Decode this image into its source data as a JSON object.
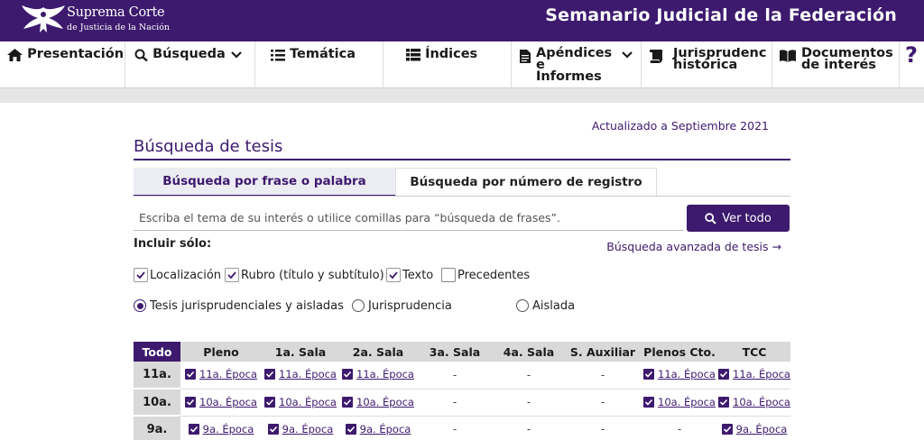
{
  "header": {
    "brand_line1": "Suprema Corte",
    "brand_line2": "de Justicia de la Nación",
    "title": "Semanario Judicial de la Federación"
  },
  "nav": {
    "presentacion": "Presentación",
    "busqueda": "Búsqueda",
    "tematica": "Temática",
    "indices": "Índices",
    "apendices_1": "Apéndices",
    "apendices_2": "e",
    "apendices_3": "Informes",
    "juris_1": "Jurisprudenc",
    "juris_2": "histórica",
    "docs_1": "Documentos",
    "docs_2": "de interés",
    "help": "?"
  },
  "updated": "Actualizado a Septiembre 2021",
  "section_title": "Búsqueda de tesis",
  "tabs": {
    "frase": "Búsqueda por frase o palabra",
    "registro": "Búsqueda por número de registro"
  },
  "search": {
    "placeholder": "Escriba el tema de su interés o utilice comillas para “búsqueda de frases”.",
    "button": "Ver todo"
  },
  "include_label": "Incluir sólo:",
  "advanced_link": "Búsqueda avanzada de tesis",
  "checks": {
    "localizacion": "Localización",
    "rubro": "Rubro (título y subtítulo)",
    "texto": "Texto",
    "precedentes": "Precedentes"
  },
  "radios": {
    "ambas": "Tesis jurisprudenciales y aisladas",
    "juris": "Jurisprudencia",
    "aislada": "Aislada"
  },
  "table": {
    "headers": {
      "todo": "Todo",
      "pleno": "Pleno",
      "sala1": "1a. Sala",
      "sala2": "2a. Sala",
      "sala3": "3a. Sala",
      "sala4": "4a. Sala",
      "aux": "S. Auxiliar",
      "plenos": "Plenos Cto.",
      "tcc": "TCC"
    },
    "rows": [
      {
        "head": "11a.",
        "link": "11a. Época",
        "dash": "-"
      },
      {
        "head": "10a.",
        "link": "10a. Época",
        "dash": "-"
      },
      {
        "head": "9a.",
        "link": "9a. Época",
        "dash": "-"
      }
    ]
  },
  "colors": {
    "brand": "#3d1a6e"
  }
}
